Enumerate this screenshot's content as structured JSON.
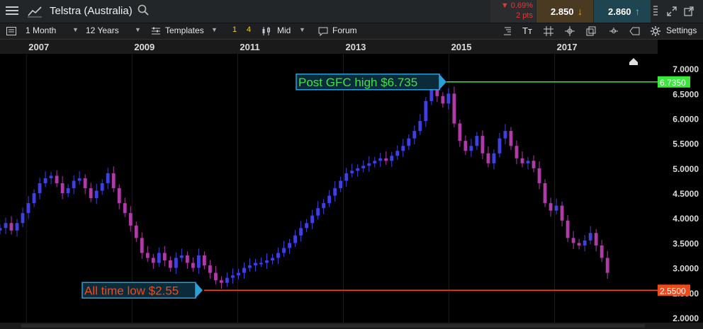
{
  "header": {
    "symbol": "Telstra (Australia)",
    "change_pct": "▼ 0.69%",
    "change_pts": "2 pts",
    "sell_price": "2.850",
    "buy_price": "2.860",
    "icons": [
      "menu-icon",
      "line-chart-icon",
      "search-icon",
      "arrow-down-icon",
      "arrow-up-icon",
      "expand-icon",
      "popout-icon"
    ]
  },
  "toolbar": {
    "interval": "1 Month",
    "range": "12 Years",
    "templates": "Templates",
    "layout_1": "1",
    "layout_4": "4",
    "price_type": "Mid",
    "forum": "Forum",
    "settings": "Settings",
    "icons": [
      "layout-icon",
      "dropdown-icon",
      "templates-icon",
      "candles-icon",
      "forum-icon",
      "drawing-icon",
      "text-icon",
      "grid-icon",
      "crosshair-icon",
      "clone-icon",
      "cursor-icon",
      "eraser-icon",
      "gear-icon"
    ]
  },
  "colors": {
    "up": "#4040e0",
    "down": "#b03aa8",
    "green": "#39e83a",
    "red": "#f04a1a",
    "callout": "#2aa0d8"
  },
  "chart_data": {
    "type": "candlestick",
    "title": "Telstra (Australia)",
    "interval": "1 Month",
    "x_tick_labels": [
      "2007",
      "2009",
      "2011",
      "2013",
      "2015",
      "2017"
    ],
    "y_tick_labels": [
      "2.0000",
      "2.5000",
      "3.0000",
      "3.5000",
      "4.0000",
      "4.5000",
      "5.0000",
      "5.5000",
      "6.0000",
      "6.5000",
      "7.0000"
    ],
    "ylim": [
      1.9,
      7.3
    ],
    "y_ticks": [
      2,
      2.5,
      3,
      3.5,
      4,
      4.5,
      5,
      5.5,
      6,
      6.5,
      7
    ],
    "x_ticks": [
      2007,
      2009,
      2011,
      2013,
      2015,
      2017
    ],
    "xlim": [
      2006.5,
      2018.95
    ],
    "annotations": [
      {
        "text": "Post GFC high $6.735",
        "value": 6.735,
        "label": "6.7350",
        "color": "#39e83a"
      },
      {
        "text": "All time low $2.55",
        "value": 2.55,
        "label": "2.5500",
        "color": "#f04a1a"
      }
    ],
    "close_series_approx": [
      3.8,
      3.9,
      3.75,
      3.9,
      4.1,
      4.3,
      4.5,
      4.7,
      4.8,
      4.85,
      4.7,
      4.5,
      4.6,
      4.75,
      4.8,
      4.6,
      4.4,
      4.55,
      4.7,
      4.9,
      4.6,
      4.3,
      4.1,
      3.85,
      3.6,
      3.3,
      3.2,
      3.1,
      3.3,
      3.15,
      3.0,
      3.2,
      3.25,
      3.1,
      3.0,
      3.25,
      3.05,
      2.9,
      2.75,
      2.7,
      2.8,
      2.85,
      2.9,
      3.0,
      3.05,
      3.1,
      3.1,
      3.15,
      3.2,
      3.3,
      3.4,
      3.5,
      3.65,
      3.8,
      3.9,
      4.05,
      4.2,
      4.3,
      4.45,
      4.6,
      4.75,
      4.9,
      4.95,
      5.0,
      5.05,
      5.1,
      5.15,
      5.2,
      5.15,
      5.25,
      5.35,
      5.45,
      5.6,
      5.75,
      5.95,
      6.35,
      6.6,
      6.45,
      6.3,
      6.5,
      5.9,
      5.55,
      5.35,
      5.45,
      5.65,
      5.3,
      5.1,
      5.3,
      5.6,
      5.75,
      5.45,
      5.2,
      5.1,
      5.15,
      5.0,
      4.7,
      4.3,
      4.15,
      4.25,
      3.95,
      3.6,
      3.5,
      3.45,
      3.55,
      3.7,
      3.45,
      3.2,
      2.9
    ]
  }
}
